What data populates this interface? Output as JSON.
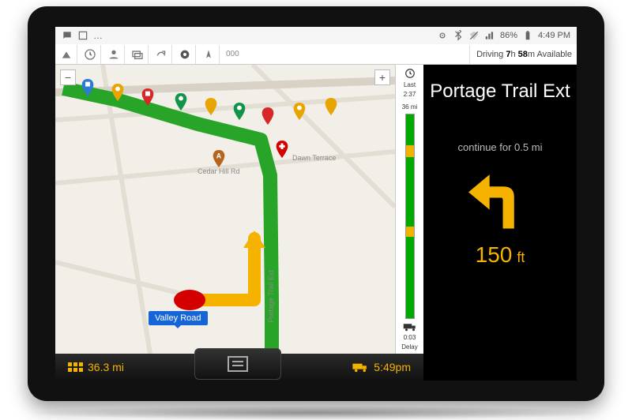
{
  "statusbar": {
    "battery_pct": "86%",
    "time": "4:49 PM"
  },
  "toolbar": {
    "omnibox": "000",
    "driving_prefix": "Driving",
    "driving_hours": "7",
    "driving_h_unit": "h",
    "driving_mins": "58",
    "driving_m_unit": "m",
    "driving_suffix": "Available"
  },
  "map": {
    "streets": {
      "cedar_hill": "Cedar Hill Rd",
      "dawn_terrace": "Dawn Terrace",
      "portage_trail_ext": "Portage Trail Ext"
    },
    "current_road": "Valley Road"
  },
  "progress": {
    "last_label": "Last",
    "last_time": "2:37",
    "total_mi": "36 mi",
    "delay_time": "0:03",
    "delay_label": "Delay"
  },
  "nav": {
    "destination": "Portage Trail Ext",
    "continue_text": "continue for 0.5 mi",
    "turn_distance": "150",
    "turn_unit": "ft"
  },
  "bottom": {
    "remaining_distance": "36.3 mi",
    "eta": "5:49pm"
  }
}
